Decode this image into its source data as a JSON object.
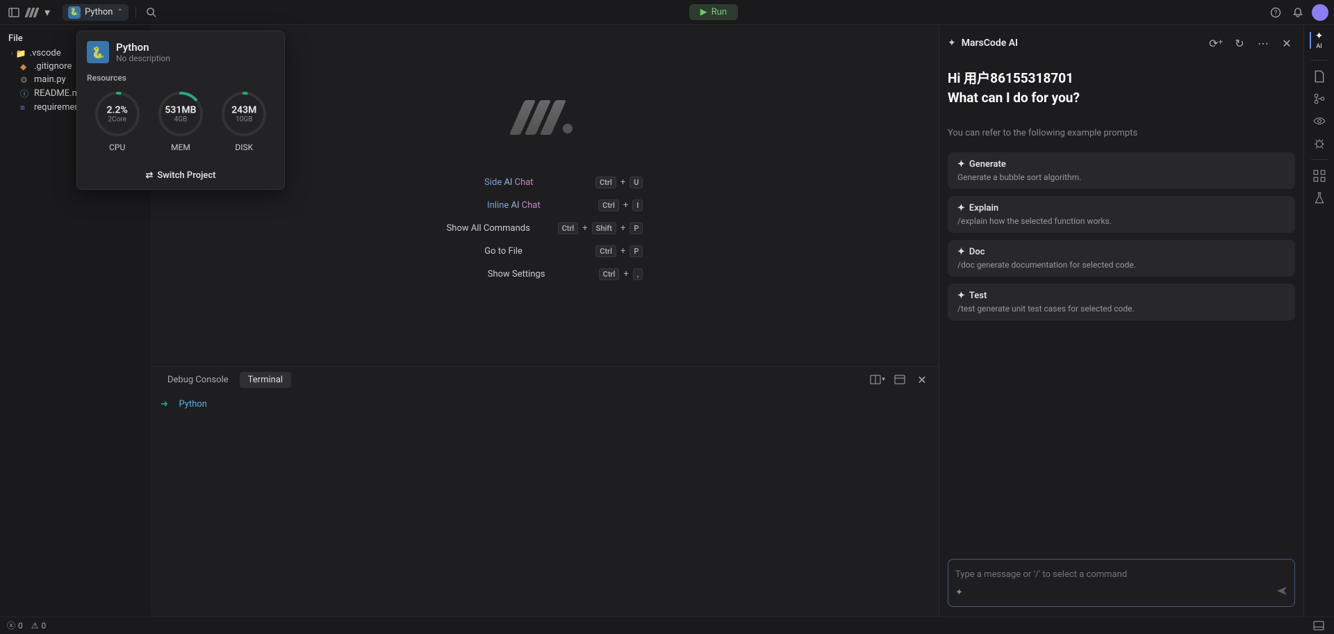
{
  "topbar": {
    "project_name": "Python",
    "run_label": "Run"
  },
  "sidebar": {
    "header": "File",
    "files": [
      {
        "icon": "📁",
        "name": ".vscode",
        "chevron": true,
        "color": "#c5a572"
      },
      {
        "icon": "◆",
        "name": ".gitignore",
        "color": "#d28445"
      },
      {
        "icon": "⚙",
        "name": "main.py",
        "color": "#888"
      },
      {
        "icon": "ⓘ",
        "name": "README.md",
        "color": "#6699cc"
      },
      {
        "icon": "≡",
        "name": "requirements.txt",
        "color": "#5588cc"
      }
    ]
  },
  "popup": {
    "project_name": "Python",
    "project_desc": "No description",
    "resources_label": "Resources",
    "cpu": {
      "value": "2.2%",
      "sub": "2Core",
      "label": "CPU",
      "pct": 2
    },
    "mem": {
      "value": "531MB",
      "sub": "4GB",
      "label": "MEM",
      "pct": 13
    },
    "disk": {
      "value": "243M",
      "sub": "10GB",
      "label": "DISK",
      "pct": 2
    },
    "switch_label": "Switch Project"
  },
  "shortcuts": [
    {
      "parts": [
        "Side",
        "AI",
        "Chat"
      ],
      "keys": [
        "Ctrl",
        "+",
        "U"
      ]
    },
    {
      "parts": [
        "Inline",
        "AI",
        "Chat"
      ],
      "keys": [
        "Ctrl",
        "+",
        "I"
      ]
    },
    {
      "plain": "Show All Commands",
      "keys": [
        "Ctrl",
        "+",
        "Shift",
        "+",
        "P"
      ]
    },
    {
      "plain": "Go to File",
      "keys": [
        "Ctrl",
        "+",
        "P"
      ]
    },
    {
      "plain": "Show Settings",
      "keys": [
        "Ctrl",
        "+",
        ","
      ]
    }
  ],
  "terminal": {
    "tabs": [
      "Debug Console",
      "Terminal"
    ],
    "active_tab": 1,
    "prompt": "➜",
    "cwd": "Python"
  },
  "ai": {
    "title": "MarsCode AI",
    "greeting": "Hi 用户86155318701",
    "subtitle": "What can I do for you?",
    "hint": "You can refer to the following example prompts",
    "prompts": [
      {
        "title": "Generate",
        "desc": "Generate a bubble sort algorithm."
      },
      {
        "title": "Explain",
        "desc": "/explain how the selected function works."
      },
      {
        "title": "Doc",
        "desc": "/doc generate documentation for selected code."
      },
      {
        "title": "Test",
        "desc": "/test generate unit test cases for selected code."
      }
    ],
    "input_placeholder": "Type a message or '/' to select a command",
    "rail_ai": "AI"
  },
  "status": {
    "errors": "0",
    "warnings": "0"
  }
}
